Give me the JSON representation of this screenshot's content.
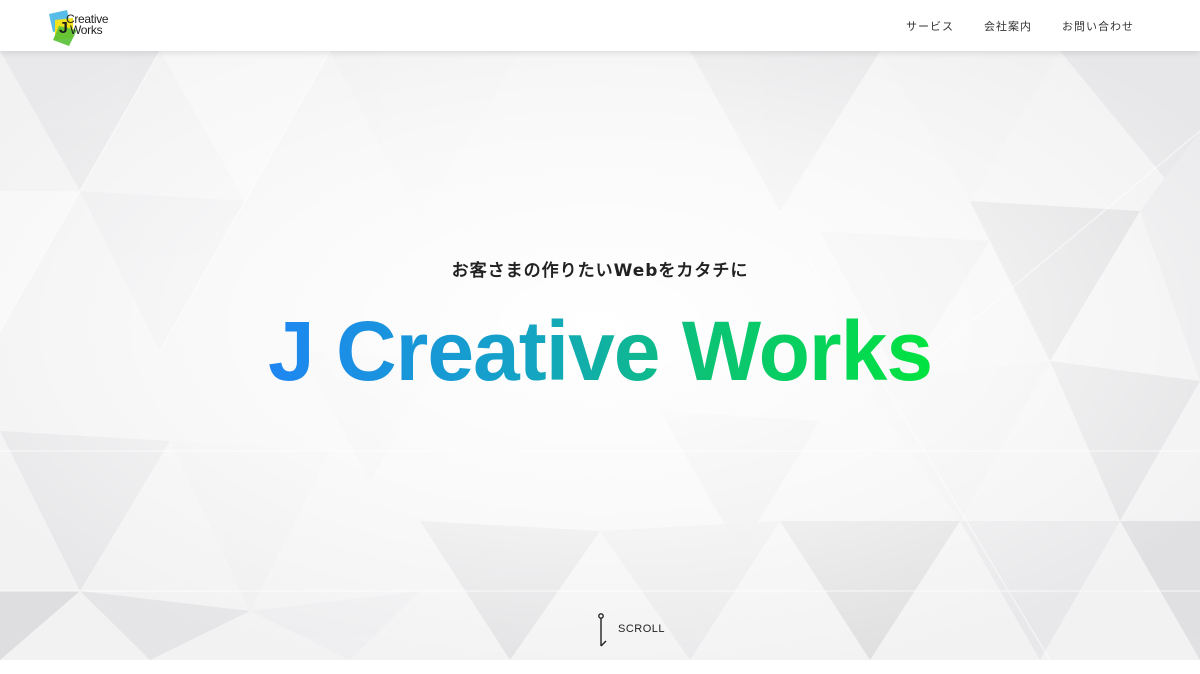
{
  "brand": {
    "logo_line1": "Creative",
    "logo_line2": "Works",
    "logo_colors": {
      "blue": "#4fb8e8",
      "yellow": "#f2e21c",
      "green": "#58c135"
    }
  },
  "nav": {
    "items": [
      {
        "label": "サービス"
      },
      {
        "label": "会社案内"
      },
      {
        "label": "お問い合わせ"
      }
    ]
  },
  "hero": {
    "tagline": "お客さまの作りたいWebをカタチに",
    "title": "J Creative Works",
    "title_gradient": [
      "#1e86f2",
      "#14a3c6",
      "#0cc277",
      "#00e33f"
    ],
    "scroll_label": "SCROLL"
  },
  "icons": {
    "scroll": "scroll-indicator-icon"
  }
}
